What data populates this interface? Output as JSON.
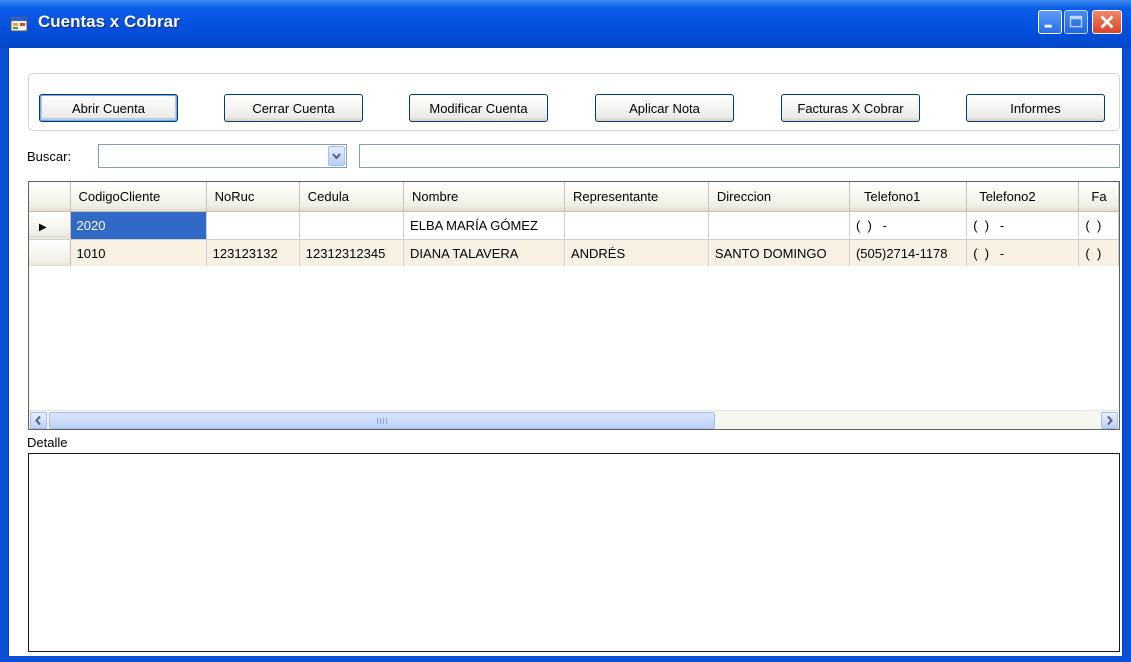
{
  "window": {
    "title": "Cuentas x Cobrar"
  },
  "toolbar": {
    "buttons": [
      {
        "label": "Abrir Cuenta"
      },
      {
        "label": "Cerrar Cuenta"
      },
      {
        "label": "Modificar Cuenta"
      },
      {
        "label": "Aplicar Nota"
      },
      {
        "label": "Facturas X Cobrar"
      },
      {
        "label": "Informes"
      }
    ]
  },
  "search": {
    "label": "Buscar:",
    "combo_value": "",
    "text_value": ""
  },
  "grid": {
    "columns": [
      "CodigoCliente",
      "NoRuc",
      "Cedula",
      "Nombre",
      "Representante",
      "Direccion",
      "Telefono1",
      "Telefono2",
      "Fa"
    ],
    "rows": [
      [
        "2020",
        "",
        "",
        "ELBA MARÍA GÓMEZ",
        "",
        "",
        "(  )   -",
        "(  )   -",
        "(  )"
      ],
      [
        "1010",
        "123123132",
        "12312312345",
        "DIANA TALAVERA",
        "ANDRÉS",
        "SANTO DOMINGO",
        "(505)2714-1178",
        "(  )   -",
        "(  )"
      ]
    ],
    "current_row_marker": "▶"
  },
  "detail": {
    "label": "Detalle"
  },
  "colors": {
    "title_bar": "#0550de",
    "selected_cell": "#3169c6",
    "alt_row": "#f8f1e3"
  }
}
